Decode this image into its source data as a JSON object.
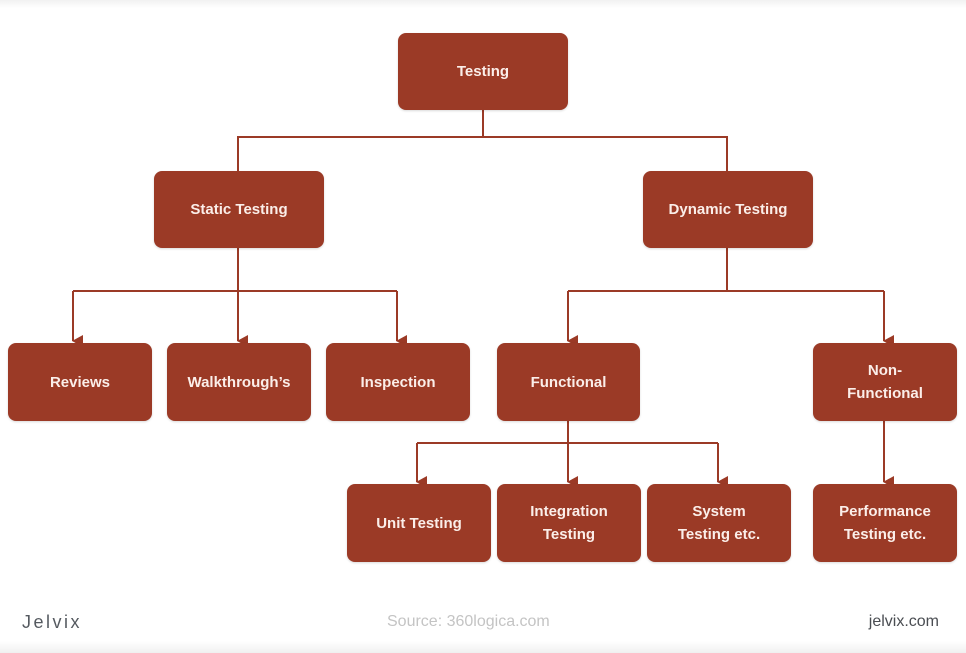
{
  "diagram": {
    "colors": {
      "node_fill": "#9b3a26",
      "node_text": "#fbeee9",
      "connector": "#9b3a26"
    },
    "nodes": {
      "testing": "Testing",
      "static_testing": "Static Testing",
      "dynamic_testing": "Dynamic Testing",
      "reviews": "Reviews",
      "walkthroughs": "Walkthrough’s",
      "inspection": "Inspection",
      "functional": "Functional",
      "non_functional": "Non-\nFunctional",
      "unit_testing": "Unit Testing",
      "integration_testing": "Integration\nTesting",
      "system_testing": "System\nTesting etc.",
      "performance_testing": "Performance\nTesting etc."
    },
    "edges": [
      [
        "testing",
        "static_testing"
      ],
      [
        "testing",
        "dynamic_testing"
      ],
      [
        "static_testing",
        "reviews"
      ],
      [
        "static_testing",
        "walkthroughs"
      ],
      [
        "static_testing",
        "inspection"
      ],
      [
        "dynamic_testing",
        "functional"
      ],
      [
        "dynamic_testing",
        "non_functional"
      ],
      [
        "functional",
        "unit_testing"
      ],
      [
        "functional",
        "integration_testing"
      ],
      [
        "functional",
        "system_testing"
      ],
      [
        "non_functional",
        "performance_testing"
      ]
    ]
  },
  "footer": {
    "brand": "Jelvix",
    "source": "Source: 360logica.com",
    "site": "jelvix.com"
  }
}
